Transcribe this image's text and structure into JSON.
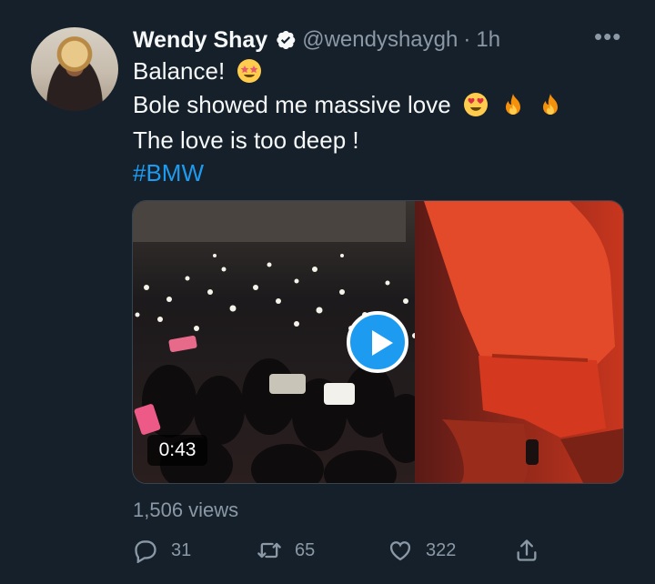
{
  "tweet": {
    "author_name": "Wendy Shay",
    "handle": "@wendyshaygh",
    "separator": "·",
    "time": "1h",
    "more_label": "•••",
    "lines": [
      "Balance!",
      "Bole showed me massive love",
      "The love is too deep !"
    ],
    "hashtag": "#BMW",
    "emoji_names": [
      "star-struck-emoji",
      "heart-eyes-emoji",
      "fire-emoji"
    ]
  },
  "media": {
    "duration": "0:43",
    "views": "1,506 views"
  },
  "actions": {
    "replies": "31",
    "retweets": "65",
    "likes": "322"
  },
  "colors": {
    "background": "#15202b",
    "accent": "#1d9bf0",
    "muted": "#8b98a5"
  }
}
